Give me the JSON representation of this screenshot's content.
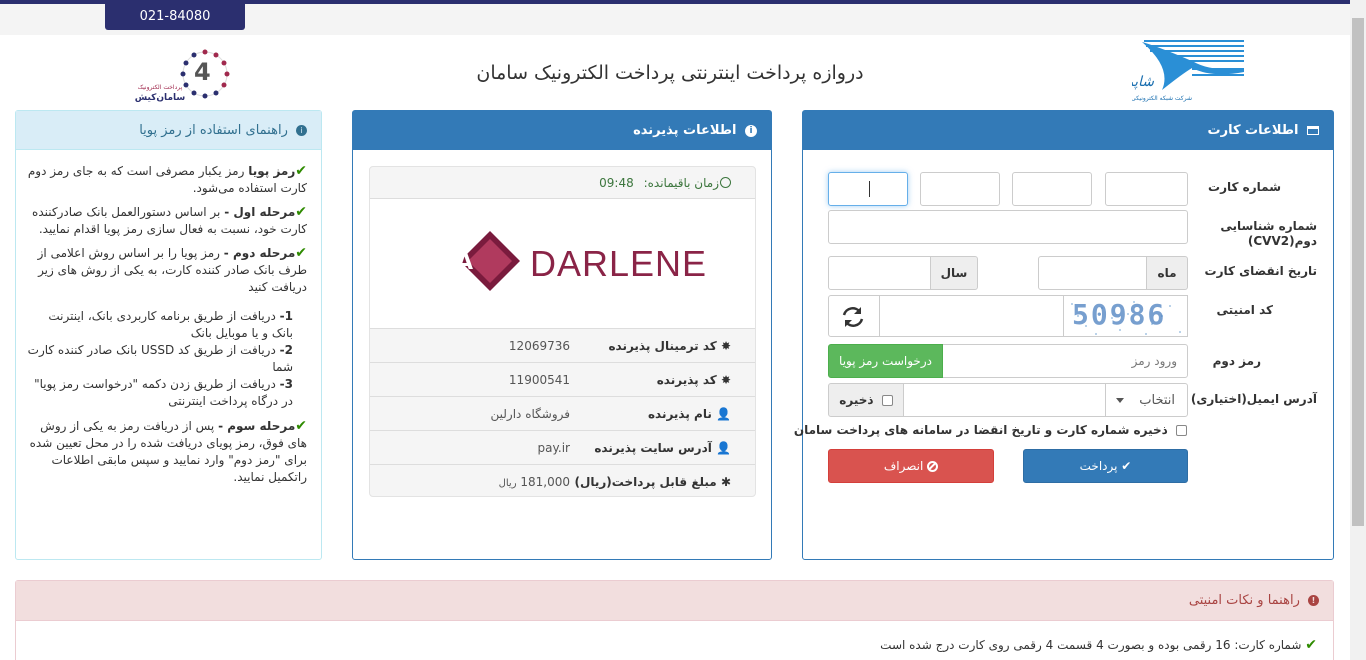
{
  "header": {
    "phone": "021-84080",
    "title": "دروازه پرداخت اینترنتی پرداخت الکترونیک سامان",
    "logo_left_text": "سامان‌کیش",
    "logo_left_sub": "پرداخت الکترونیک",
    "logo_left_number": "4"
  },
  "card_panel": {
    "title": "اطلاعات کارت",
    "card_number_label": "شماره کارت",
    "cvv2_label": "شماره شناسایی دوم(CVV2)",
    "expiry_label": "تاریخ انقضای کارت",
    "month_label": "ماه",
    "year_label": "سال",
    "captcha_label": "کد امنیتی",
    "captcha_text": "50986",
    "pin2_label": "رمز دوم",
    "pin2_placeholder": "ورود رمز",
    "request_pin_button": "درخواست رمز پویا",
    "email_label": "آدرس ایمیل(اختیاری)",
    "email_select": "انتخاب",
    "save_label": "ذخیره",
    "save_card_label": "ذخیره شماره کارت و تاریخ انقضا در سامانه های پرداخت سامان",
    "pay_button": "پرداخت",
    "cancel_button": "انصراف"
  },
  "merchant_panel": {
    "title": "اطلاعات پذیرنده",
    "timer_label": "زمان باقیمانده:",
    "timer_value": "09:48",
    "logo_text": "DARLENE",
    "rows": [
      {
        "key": "کد ترمینال پذیرنده",
        "value": "12069736"
      },
      {
        "key": "کد پذیرنده",
        "value": "11900541"
      },
      {
        "key": "نام پذیرنده",
        "value": "فروشگاه دارلین"
      },
      {
        "key": "آدرس سایت پذیرنده",
        "value": "pay.ir"
      },
      {
        "key": "مبلغ قابل پرداخت(ریال)",
        "value": "181,000",
        "unit": "ریال"
      }
    ]
  },
  "guide_panel": {
    "title": "راهنمای استفاده از رمز پویا",
    "p1_bold": "رمز پویا",
    "p1_text": "رمز یکبار مصرفی است که به جای رمز دوم کارت استفاده می‌شود.",
    "p2_bold": "مرحله اول -",
    "p2_text": "بر اساس دستورالعمل بانک صادرکننده کارت خود، نسبت به فعال سازی رمز پویا اقدام نمایید.",
    "p3_bold": "مرحله دوم -",
    "p3_text": "رمز پویا را بر اساس روش اعلامی از طرف بانک صادر کننده کارت، به یکی از روش های زیر دریافت کنید",
    "steps": [
      {
        "num": "1-",
        "text": "دریافت از طریق برنامه کاربردی بانک، اینترنت بانک و یا موبایل بانک"
      },
      {
        "num": "2-",
        "text": "دریافت از طریق کد USSD بانک صادر کننده کارت شما"
      },
      {
        "num": "3-",
        "text": "دریافت از طریق زدن دکمه \"درخواست رمز پویا\" در درگاه پرداخت اینترنتی"
      }
    ],
    "p4_bold": "مرحله سوم -",
    "p4_text": "پس از دریافت رمز به یکی از روش های فوق، رمز پویای دریافت شده را در محل تعیین شده برای \"رمز دوم\" وارد نمایید و سپس مابقی اطلاعات راتکمیل نمایید."
  },
  "tips_panel": {
    "title": "راهنما و نکات امنیتی",
    "line1": "شماره کارت: 16 رقمی بوده و بصورت 4 قسمت 4 رقمی روی کارت درج شده است"
  }
}
